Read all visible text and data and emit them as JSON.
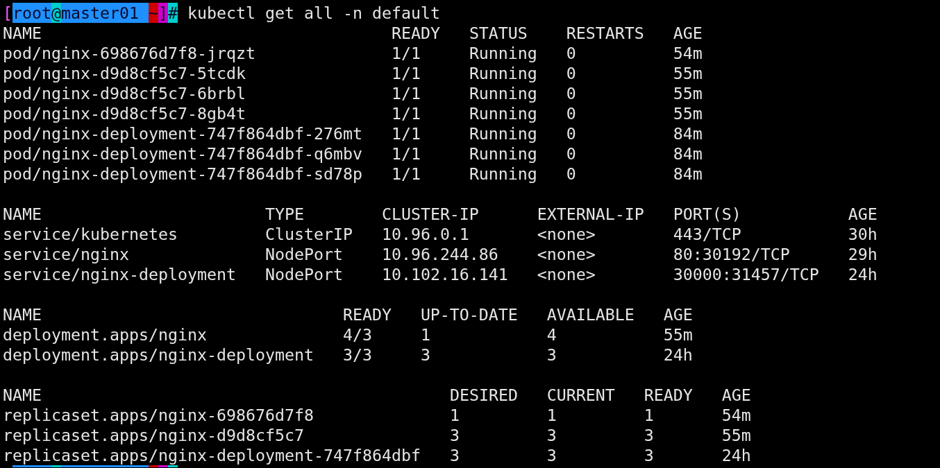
{
  "prompt": {
    "segments": [
      {
        "kind": "bracket",
        "text": "["
      },
      {
        "kind": "user",
        "text": "root"
      },
      {
        "kind": "at",
        "text": "@"
      },
      {
        "kind": "host",
        "text": "master01 "
      },
      {
        "kind": "path",
        "text": "~"
      },
      {
        "kind": "bracket_close",
        "text": "]"
      },
      {
        "kind": "sign",
        "text": "#"
      }
    ],
    "command": "kubectl get all -n default"
  },
  "tables": [
    {
      "columns": [
        "NAME",
        "READY",
        "STATUS",
        "RESTARTS",
        "AGE"
      ],
      "rows": [
        [
          "pod/nginx-698676d7f8-jrqzt",
          "1/1",
          "Running",
          "0",
          "54m"
        ],
        [
          "pod/nginx-d9d8cf5c7-5tcdk",
          "1/1",
          "Running",
          "0",
          "55m"
        ],
        [
          "pod/nginx-d9d8cf5c7-6brbl",
          "1/1",
          "Running",
          "0",
          "55m"
        ],
        [
          "pod/nginx-d9d8cf5c7-8gb4t",
          "1/1",
          "Running",
          "0",
          "55m"
        ],
        [
          "pod/nginx-deployment-747f864dbf-276mt",
          "1/1",
          "Running",
          "0",
          "84m"
        ],
        [
          "pod/nginx-deployment-747f864dbf-q6mbv",
          "1/1",
          "Running",
          "0",
          "84m"
        ],
        [
          "pod/nginx-deployment-747f864dbf-sd78p",
          "1/1",
          "Running",
          "0",
          "84m"
        ]
      ]
    },
    {
      "columns": [
        "NAME",
        "TYPE",
        "CLUSTER-IP",
        "EXTERNAL-IP",
        "PORT(S)",
        "AGE"
      ],
      "rows": [
        [
          "service/kubernetes",
          "ClusterIP",
          "10.96.0.1",
          "<none>",
          "443/TCP",
          "30h"
        ],
        [
          "service/nginx",
          "NodePort",
          "10.96.244.86",
          "<none>",
          "80:30192/TCP",
          "29h"
        ],
        [
          "service/nginx-deployment",
          "NodePort",
          "10.102.16.141",
          "<none>",
          "30000:31457/TCP",
          "24h"
        ]
      ]
    },
    {
      "columns": [
        "NAME",
        "READY",
        "UP-TO-DATE",
        "AVAILABLE",
        "AGE"
      ],
      "rows": [
        [
          "deployment.apps/nginx",
          "4/3",
          "1",
          "4",
          "55m"
        ],
        [
          "deployment.apps/nginx-deployment",
          "3/3",
          "3",
          "3",
          "24h"
        ]
      ]
    },
    {
      "columns": [
        "NAME",
        "DESIRED",
        "CURRENT",
        "READY",
        "AGE"
      ],
      "rows": [
        [
          "replicaset.apps/nginx-698676d7f8",
          "1",
          "1",
          "1",
          "54m"
        ],
        [
          "replicaset.apps/nginx-d9d8cf5c7",
          "3",
          "3",
          "3",
          "55m"
        ],
        [
          "replicaset.apps/nginx-deployment-747f864dbf",
          "3",
          "3",
          "3",
          "24h"
        ]
      ]
    }
  ],
  "next_prompt": {
    "cut_off": true
  }
}
